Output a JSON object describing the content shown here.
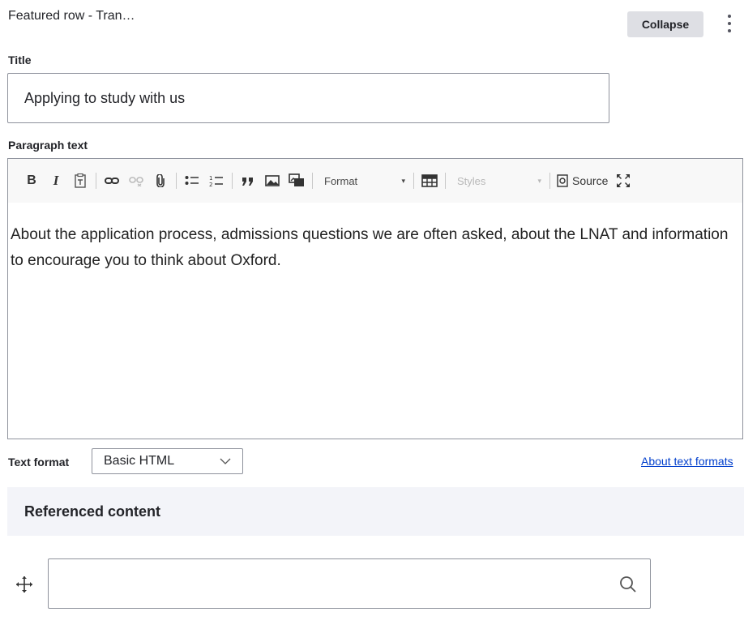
{
  "header": {
    "row_title": "Featured row - Tran…",
    "collapse_label": "Collapse"
  },
  "title_field": {
    "label": "Title",
    "value": "Applying to study with us"
  },
  "paragraph_field": {
    "label": "Paragraph text",
    "toolbar": {
      "bold": "B",
      "italic": "I",
      "format_label": "Format",
      "styles_label": "Styles",
      "source_label": "Source"
    },
    "content": "About the application process, admissions questions we are often asked, about the LNAT and information to encourage you to think about Oxford."
  },
  "text_format": {
    "label": "Text format",
    "selected": "Basic HTML",
    "about_link": "About text formats"
  },
  "referenced_content": {
    "title": "Referenced content",
    "search_value": ""
  },
  "icons": [
    "kebab-menu-icon",
    "paste-text-icon",
    "link-icon",
    "unlink-icon",
    "attachment-icon",
    "bulleted-list-icon",
    "numbered-list-icon",
    "blockquote-icon",
    "image-icon",
    "media-embed-icon",
    "table-icon",
    "source-icon",
    "maximize-icon",
    "chevron-down-icon",
    "move-handle-icon",
    "search-icon"
  ]
}
